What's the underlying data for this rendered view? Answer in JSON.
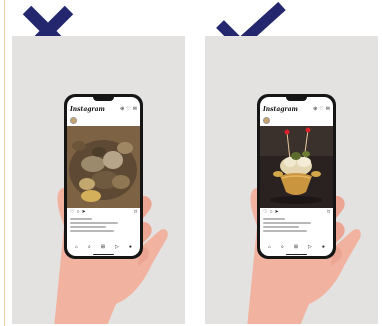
{
  "colors": {
    "mark": "#24266e",
    "panel": "#e3e2e0",
    "skin": "#f2b2a0",
    "phone": "#151515"
  },
  "marks": {
    "left": "cross-icon",
    "right": "check-icon"
  },
  "phones": {
    "left": {
      "app_title": "Instagram",
      "user": "",
      "icons": [
        "heart-icon",
        "messenger-icon",
        "comment-icon",
        "share-icon",
        "bookmark-icon",
        "home-icon",
        "search-icon",
        "add-icon",
        "reels-icon",
        "profile-icon"
      ]
    },
    "right": {
      "app_title": "Instagram",
      "user": "",
      "icons": [
        "heart-icon",
        "messenger-icon",
        "comment-icon",
        "share-icon",
        "bookmark-icon",
        "home-icon",
        "search-icon",
        "add-icon",
        "reels-icon",
        "profile-icon"
      ]
    }
  }
}
